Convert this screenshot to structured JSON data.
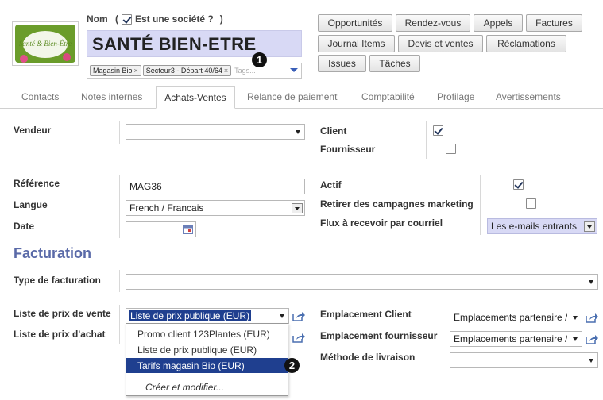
{
  "header": {
    "logo_text": "Santé & Bien-Être",
    "name_label": "Nom",
    "company_open": "(",
    "company_label": "Est une société ?",
    "company_close": ")",
    "company_checked": true,
    "name_value": "SANTÉ BIEN-ETRE",
    "tags": [
      {
        "label": "Magasin Bio"
      },
      {
        "label": "Secteur3 - Départ 40/64"
      }
    ],
    "tags_placeholder": "Tags...",
    "badge_1": "1"
  },
  "action_buttons": [
    {
      "label": "Opportunités"
    },
    {
      "label": "Rendez-vous"
    },
    {
      "label": "Appels"
    },
    {
      "label": "Factures"
    },
    {
      "label": "Journal Items"
    },
    {
      "label": "Devis et ventes"
    },
    {
      "label": "Réclamations"
    },
    {
      "label": "Issues"
    },
    {
      "label": "Tâches"
    }
  ],
  "tabs": [
    {
      "label": "Contacts"
    },
    {
      "label": "Notes internes"
    },
    {
      "label": "Achats-Ventes",
      "active": true
    },
    {
      "label": "Relance de paiement"
    },
    {
      "label": "Comptabilité"
    },
    {
      "label": "Profilage"
    },
    {
      "label": "Avertissements"
    }
  ],
  "form": {
    "vendeur_label": "Vendeur",
    "vendeur_value": "",
    "client_label": "Client",
    "client_checked": true,
    "fournisseur_label": "Fournisseur",
    "fournisseur_checked": false,
    "reference_label": "Référence",
    "reference_value": "MAG36",
    "langue_label": "Langue",
    "langue_value": "French / Francais",
    "date_label": "Date",
    "date_value": "",
    "actif_label": "Actif",
    "actif_checked": true,
    "retirer_label": "Retirer des campagnes marketing",
    "retirer_checked": false,
    "flux_label": "Flux à recevoir par courriel",
    "flux_value": "Les e-mails entrants"
  },
  "facturation": {
    "title": "Facturation",
    "type_label": "Type de facturation",
    "type_value": "",
    "prix_vente_label": "Liste de prix de vente",
    "prix_vente_value": "Liste de prix publique (EUR)",
    "prix_achat_label": "Liste de prix d'achat",
    "emplacement_client_label": "Emplacement Client",
    "emplacement_client_value": "Emplacements partenaire /",
    "emplacement_fournisseur_label": "Emplacement fournisseur",
    "emplacement_fournisseur_value": "Emplacements partenaire /",
    "methode_label": "Méthode de livraison",
    "methode_value": ""
  },
  "dropdown": {
    "items": [
      {
        "label": "Promo client 123Plantes (EUR)"
      },
      {
        "label": "Liste de prix publique (EUR)"
      },
      {
        "label": "Tarifs magasin Bio (EUR)",
        "highlighted": true
      }
    ],
    "create_label": "Créer et modifier...",
    "badge_2": "2"
  },
  "colors": {
    "name_bg": "#d8d9f5",
    "section_title": "#5a6aa8",
    "highlight": "#1f3f8f",
    "flux_bg": "#d8d9f5"
  }
}
